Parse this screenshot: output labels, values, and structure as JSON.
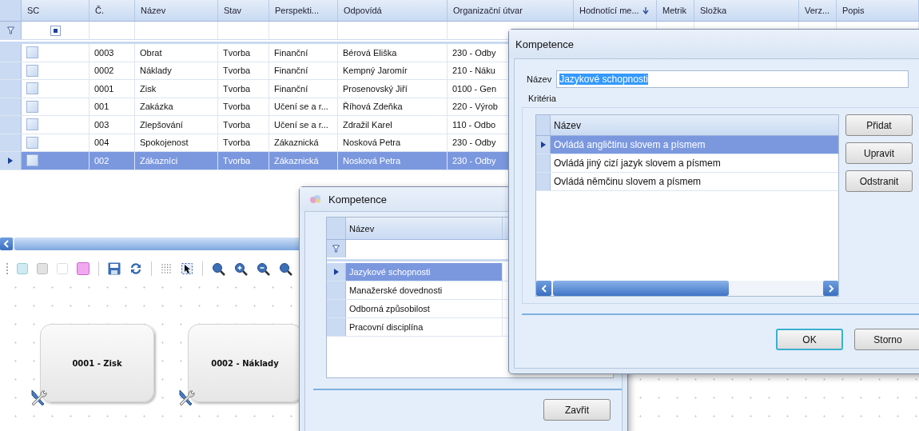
{
  "main_grid": {
    "columns": [
      {
        "label": "SC",
        "sorted": false
      },
      {
        "label": "Č.",
        "sorted": false
      },
      {
        "label": "Název",
        "sorted": false
      },
      {
        "label": "Stav",
        "sorted": false
      },
      {
        "label": "Perspekti...",
        "sorted": false
      },
      {
        "label": "Odpovídá",
        "sorted": false
      },
      {
        "label": "Organizační útvar",
        "sorted": false
      },
      {
        "label": "Hodnotící me...",
        "sorted": true
      },
      {
        "label": "Metrik",
        "sorted": false
      },
      {
        "label": "Složka",
        "sorted": false
      },
      {
        "label": "Verz...",
        "sorted": false
      },
      {
        "label": "Popis",
        "sorted": false
      }
    ],
    "filter_sc_checked": true,
    "rows": [
      {
        "number": "0003",
        "name": "Obrat",
        "state": "Tvorba",
        "perspective": "Finanční",
        "owner": "Bérová Eliška",
        "unit": "230 - Odby",
        "sc_checked": false,
        "selected": false
      },
      {
        "number": "0002",
        "name": "Náklady",
        "state": "Tvorba",
        "perspective": "Finanční",
        "owner": "Kempný Jaromír",
        "unit": "210 - Náku",
        "sc_checked": false,
        "selected": false
      },
      {
        "number": "0001",
        "name": "Zisk",
        "state": "Tvorba",
        "perspective": "Finanční",
        "owner": "Prosenovský Jiří",
        "unit": "0100 - Gen",
        "sc_checked": false,
        "selected": false
      },
      {
        "number": "001",
        "name": "Zakázka",
        "state": "Tvorba",
        "perspective": "Učení se a r...",
        "owner": "Říhová Zdeňka",
        "unit": "220 - Výrob",
        "sc_checked": false,
        "selected": false
      },
      {
        "number": "003",
        "name": "Zlepšování",
        "state": "Tvorba",
        "perspective": "Učení se a r...",
        "owner": "Zdražil Karel",
        "unit": "110 - Odbo",
        "sc_checked": false,
        "selected": false
      },
      {
        "number": "004",
        "name": "Spokojenost",
        "state": "Tvorba",
        "perspective": "Zákaznická",
        "owner": "Nosková Petra",
        "unit": "230 - Odby",
        "sc_checked": false,
        "selected": false
      },
      {
        "number": "002",
        "name": "Zákazníci",
        "state": "Tvorba",
        "perspective": "Zákaznická",
        "owner": "Nosková Petra",
        "unit": "230 - Odby",
        "sc_checked": false,
        "selected": true
      }
    ]
  },
  "canvas": {
    "nodes": [
      {
        "label": "0001 - Zisk"
      },
      {
        "label": "0002 - Náklady"
      }
    ]
  },
  "list_dialog": {
    "title": "Kompetence",
    "column": "Název",
    "items": [
      {
        "name": "Jazykové schopnosti",
        "selected": true
      },
      {
        "name": "Manažerské dovednosti",
        "selected": false
      },
      {
        "name": "Odborná způsobilost",
        "selected": false
      },
      {
        "name": "Pracovní disciplína",
        "selected": false
      }
    ],
    "close_button": "Zavřit"
  },
  "edit_dialog": {
    "title": "Kompetence",
    "name_label": "Název",
    "name_value": "Jazykové schopnosti",
    "name_text_selected": true,
    "group_label": "Kritéria",
    "column": "Název",
    "criteria": [
      {
        "name": "Ovládá angličtinu slovem a písmem",
        "selected": true
      },
      {
        "name": "Ovládá jiný cizí jazyk slovem a písmem",
        "selected": false
      },
      {
        "name": "Ovládá němčinu slovem a písmem",
        "selected": false
      }
    ],
    "side_buttons": [
      "Přidat",
      "Upravit",
      "Odstranit"
    ],
    "ok_button": "OK",
    "cancel_button": "Storno"
  }
}
